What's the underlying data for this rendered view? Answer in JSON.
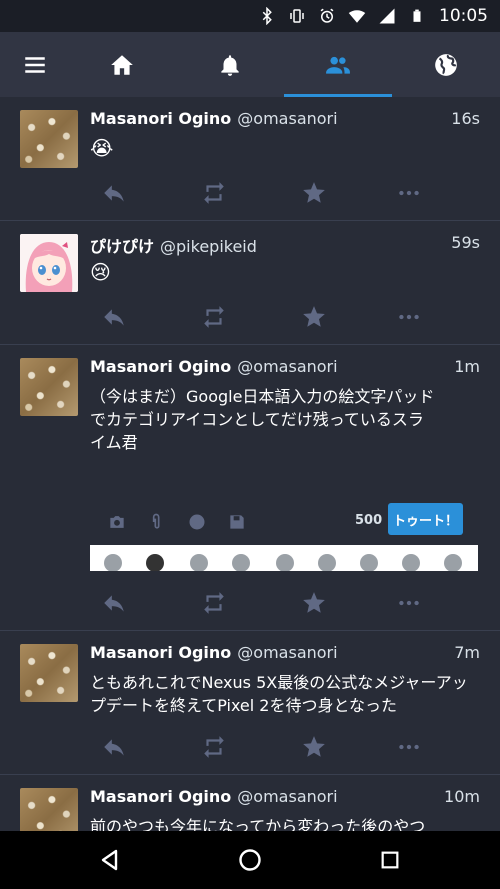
{
  "status_bar": {
    "time": "10:05",
    "icons": [
      "bluetooth-icon",
      "vibrate-icon",
      "alarm-icon",
      "wifi-icon",
      "signal-icon",
      "battery-icon"
    ]
  },
  "nav": {
    "tabs": [
      "menu-icon",
      "home-icon",
      "notifications-bell-icon",
      "local-timeline-people-icon",
      "federated-globe-icon"
    ],
    "active_tab": "local-timeline-people-icon",
    "colors": {
      "active": "#2b90d9",
      "inactive": "#ffffff"
    }
  },
  "statuses": [
    {
      "display_name": "Masanori Ogino",
      "acct": "@omasanori",
      "time": "16s",
      "content": "😭"
    },
    {
      "display_name": "ぴけぴけ",
      "acct": "@pikepikeid",
      "time": "59s",
      "content": "😢"
    },
    {
      "display_name": "Masanori Ogino",
      "acct": "@omasanori",
      "time": "1m",
      "content": "（今はまだ）Google日本語入力の絵文字パッドでカテゴリアイコンとしてだけ残っているスライム君",
      "media": {
        "char_count": "500",
        "toot_button": "トゥート！"
      }
    },
    {
      "display_name": "Masanori Ogino",
      "acct": "@omasanori",
      "time": "7m",
      "content": "ともあれこれでNexus 5X最後の公式なメジャーアップデートを終えてPixel 2を待つ身となった"
    },
    {
      "display_name": "Masanori Ogino",
      "acct": "@omasanori",
      "time": "10m",
      "content": "前のやつも今年になってから変わった後のやつ"
    }
  ],
  "colors": {
    "background": "#282c37",
    "navbar": "#313543",
    "statusbar": "#1b1e26",
    "accent": "#2b90d9",
    "action_icon": "#606984"
  }
}
